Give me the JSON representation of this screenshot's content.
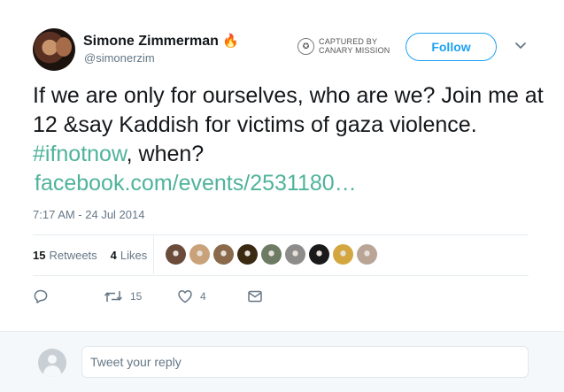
{
  "author": {
    "name": "Simone Zimmerman",
    "handle": "@simonerzim",
    "badge_emoji": "🔥"
  },
  "canary_mark": {
    "line1": "CAPTURED BY",
    "line2": "CANARY MISSION"
  },
  "follow_label": "Follow",
  "tweet": {
    "text_before": "If we are only for ourselves, who are we? Join me at 12 &say Kaddish for victims of gaza violence. ",
    "hashtag": "#ifnotnow",
    "text_after": ", when?",
    "link": "facebook.com/events/2531180…"
  },
  "timestamp": "7:17 AM - 24 Jul 2014",
  "stats": {
    "retweets_count": "15",
    "retweets_label": "Retweets",
    "likes_count": "4",
    "likes_label": "Likes"
  },
  "likers": [
    {
      "icon": "liker-avatar",
      "color": "#6b4b3a"
    },
    {
      "icon": "liker-avatar",
      "color": "#c9a27a"
    },
    {
      "icon": "liker-avatar",
      "color": "#8a6a4a"
    },
    {
      "icon": "liker-avatar",
      "color": "#3b2a12"
    },
    {
      "icon": "liker-avatar",
      "color": "#6d7b64"
    },
    {
      "icon": "liker-avatar",
      "color": "#8e8c8a"
    },
    {
      "icon": "liker-avatar",
      "color": "#1a1a1a"
    },
    {
      "icon": "liker-avatar",
      "color": "#d4a640"
    },
    {
      "icon": "liker-avatar",
      "color": "#b9a496"
    }
  ],
  "actions": {
    "reply_count": "",
    "retweet_count": "15",
    "like_count": "4"
  },
  "reply": {
    "placeholder": "Tweet your reply"
  },
  "colors": {
    "accent": "#1da1f2",
    "link": "#4fb39a",
    "muted": "#657786"
  }
}
